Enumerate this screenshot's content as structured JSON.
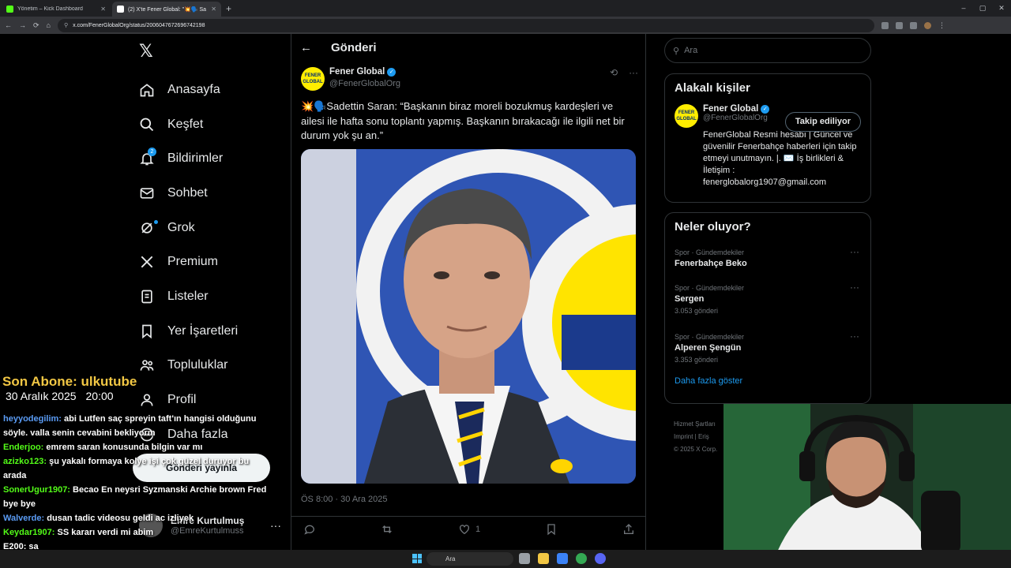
{
  "browser": {
    "tabs": [
      {
        "title": "Yönetim – Kick Dashboard",
        "active": false,
        "favicon_color": "#53fc18"
      },
      {
        "title": "(2) X'te Fener Global: \"💥🗣️ Sa…",
        "active": true,
        "favicon_color": "#ffffff"
      }
    ],
    "new_tab": "+",
    "url": "x.com/FenerGlobalOrg/status/2006047672696742198",
    "window_controls": [
      "–",
      "▢",
      "✕"
    ]
  },
  "x_nav": {
    "logo": "𝕏",
    "items": [
      {
        "label": "Anasayfa",
        "icon": "home-icon"
      },
      {
        "label": "Keşfet",
        "icon": "search-icon"
      },
      {
        "label": "Bildirimler",
        "icon": "bell-icon",
        "badge": "2"
      },
      {
        "label": "Sohbet",
        "icon": "mail-icon"
      },
      {
        "label": "Grok",
        "icon": "grok-icon",
        "dot": true
      },
      {
        "label": "Premium",
        "icon": "x-premium-icon"
      },
      {
        "label": "Listeler",
        "icon": "list-icon"
      },
      {
        "label": "Yer İşaretleri",
        "icon": "bookmark-icon"
      },
      {
        "label": "Topluluklar",
        "icon": "people-icon"
      },
      {
        "label": "Profil",
        "icon": "person-icon"
      },
      {
        "label": "Daha fazla",
        "icon": "more-icon"
      }
    ],
    "post_button": "Gönderi yayınla",
    "profile": {
      "name": "Emre Kurtulmuş",
      "handle": "@EmreKurtulmuss",
      "more": "···"
    }
  },
  "post": {
    "header_title": "Gönderi",
    "author_name": "Fener Global",
    "author_handle": "@FenerGlobalOrg",
    "avatar_text": "FENER GLOBAL",
    "text": "💥🗣️Sadettin Saran: “Başkanın biraz moreli bozukmuş kardeşleri ve ailesi ile hafta sonu toplantı yapmış. Başkanın bırakacağı ile ilgili net bir durum yok şu an.”",
    "timestamp": "ÖS 8:00 · 30 Ara 2025",
    "likes": "1",
    "more": "···"
  },
  "right": {
    "search_placeholder": "Ara",
    "relevant_title": "Alakalı kişiler",
    "relevant_person": {
      "name": "Fener Global",
      "handle": "@FenerGlobalOrg",
      "follow_label": "Takip ediliyor",
      "bio": "FenerGlobal Resmi hesabı | Güncel ve güvenilir Fenerbahçe haberleri için takip etmeyi unutmayın. |. ✉️ İş birlikleri & İletişim : fenerglobalorg1907@gmail.com"
    },
    "trends_title": "Neler oluyor?",
    "trends": [
      {
        "category": "Spor · Gündemdekiler",
        "name": "Fenerbahçe Beko",
        "count": ""
      },
      {
        "category": "Spor · Gündemdekiler",
        "name": "Sergen",
        "count": "3.053 gönderi"
      },
      {
        "category": "Spor · Gündemdekiler",
        "name": "Alperen Şengün",
        "count": "3.353 gönderi"
      }
    ],
    "show_more": "Daha fazla göster",
    "footer": [
      "Hizmet Şartları",
      "Imprint |  Eriş",
      "© 2025 X Corp."
    ]
  },
  "stream": {
    "last_sub": "Son Abone: ulkutube",
    "date": "30 Aralık 2025",
    "time": "20:00",
    "chat": [
      {
        "user": "heyyodegilim:",
        "color": "#5b9cf5",
        "msg": "abi Lutfen saç spreyin taft'ın hangisi olduğunu söyle. valla senin cevabini bekliyorm"
      },
      {
        "user": "Enderjoo:",
        "color": "#53fc18",
        "msg": "emrem saran konusunda bilgin var mı"
      },
      {
        "user": "azizko123:",
        "color": "#53fc18",
        "msg": "şu yakalı formaya kolye işi çok güzel duruyor bu arada"
      },
      {
        "user": "SonerUgur1907:",
        "color": "#53fc18",
        "msg": "Becao En neysri Syzmanski Archie brown Fred bye bye"
      },
      {
        "user": "Walverde:",
        "color": "#5b9cf5",
        "msg": "dusan tadic videosu geldi ac izliyek"
      },
      {
        "user": "Keydar1907:",
        "color": "#53fc18",
        "msg": "SS kararı verdi mi abim"
      },
      {
        "user": "E200:",
        "color": "#ffffff",
        "msg": "sa"
      }
    ]
  },
  "taskbar": {
    "search": "Ara"
  },
  "status_url": "https://x.com/search?q=..."
}
